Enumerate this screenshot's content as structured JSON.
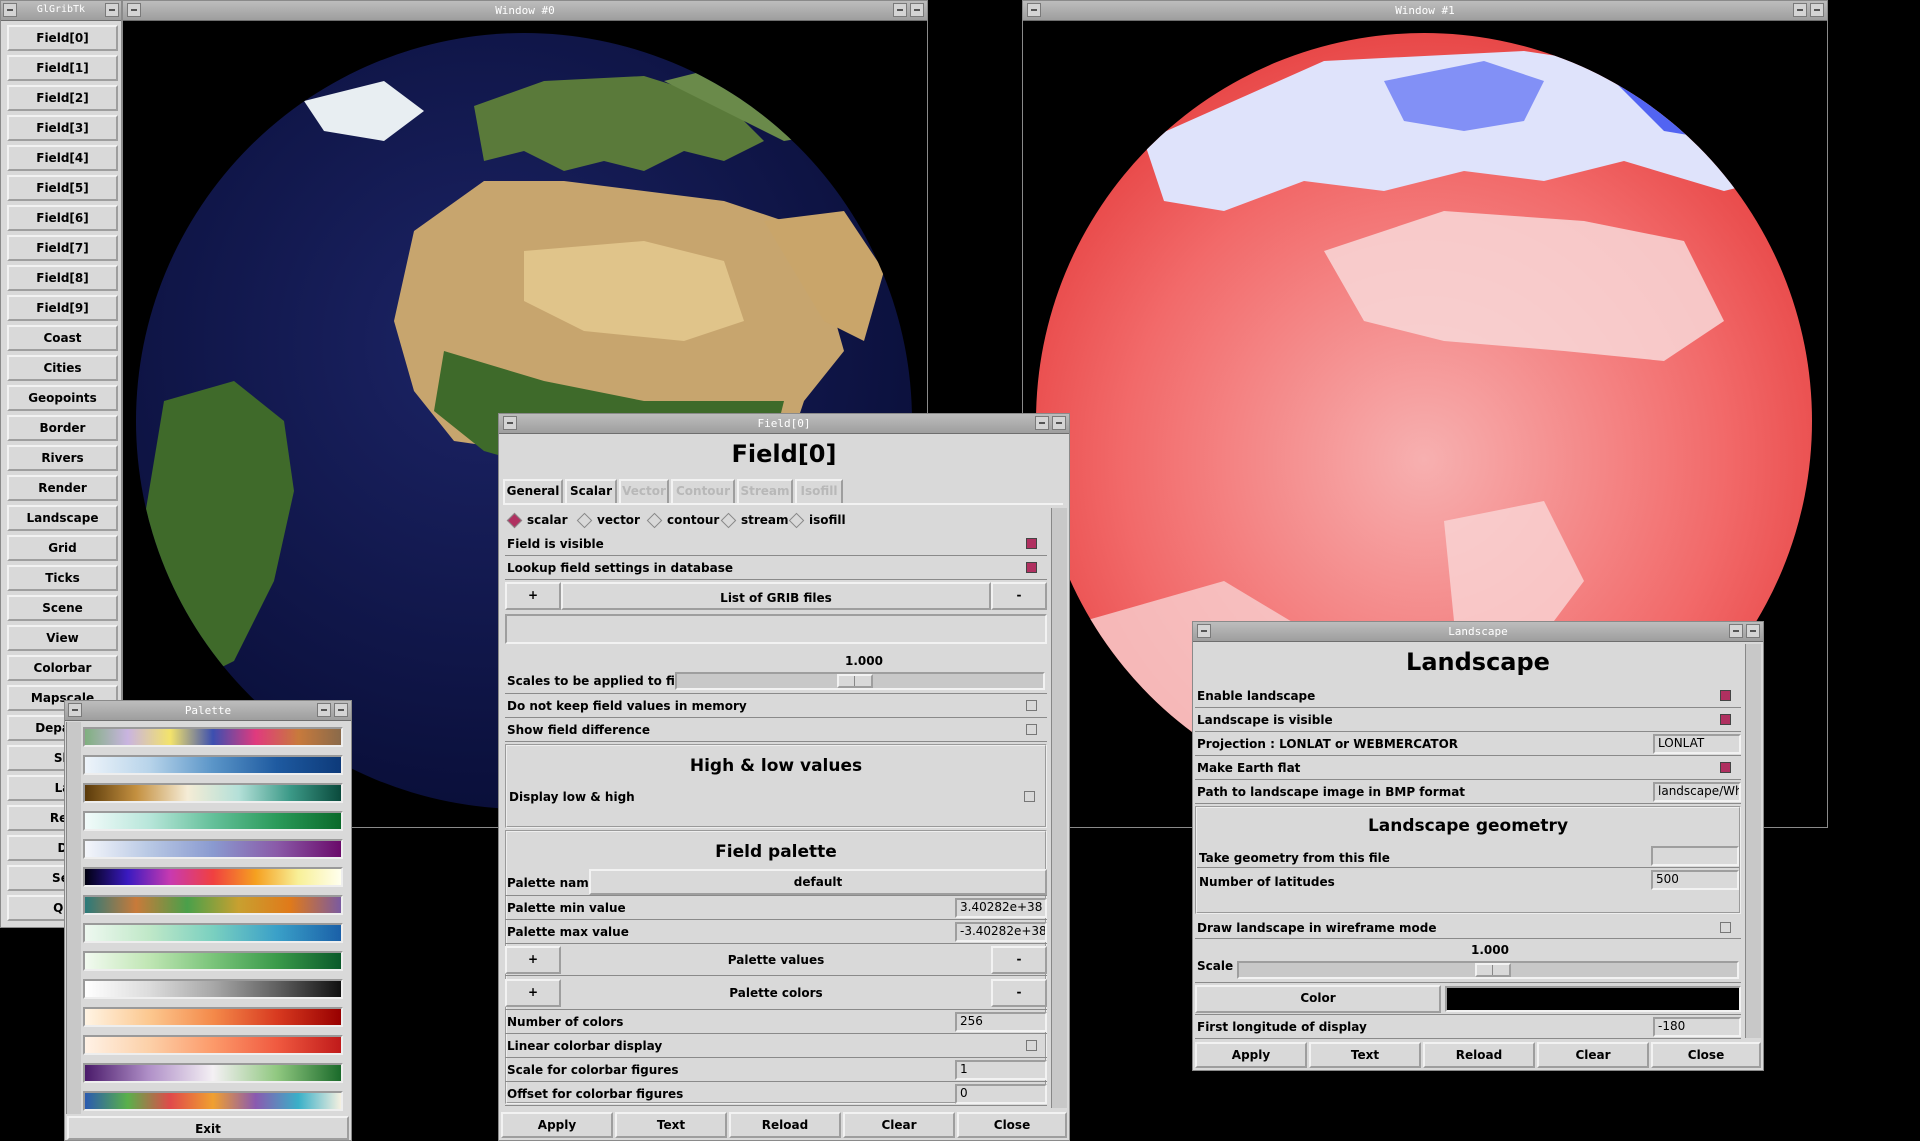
{
  "main_menu": {
    "title": "GlGribTk",
    "items": [
      "Field[0]",
      "Field[1]",
      "Field[2]",
      "Field[3]",
      "Field[4]",
      "Field[5]",
      "Field[6]",
      "Field[7]",
      "Field[8]",
      "Field[9]",
      "Coast",
      "Cities",
      "Geopoints",
      "Border",
      "Rivers",
      "Render",
      "Landscape",
      "Grid",
      "Ticks",
      "Scene",
      "View",
      "Colorbar",
      "Mapscale",
      "Departe",
      "Sh",
      "La",
      "Rev",
      "D",
      "Sel",
      "Qu"
    ]
  },
  "window0": {
    "title": "Window #0"
  },
  "window1": {
    "title": "Window #1"
  },
  "palette_window": {
    "title": "Palette",
    "exit_label": "Exit",
    "palettes": [
      [
        "#7fb07f",
        "#c9b4e0",
        "#f3e36b",
        "#3c4fb0",
        "#e03a7e",
        "#c87a3c",
        "#8a6a4a"
      ],
      [
        "#eef4fa",
        "#b8d4ea",
        "#5a95c8",
        "#1e5aa0",
        "#0d3a7a"
      ],
      [
        "#5a3a0a",
        "#c49040",
        "#f5ecd6",
        "#b4e0d8",
        "#3c9a88",
        "#0a4a3c"
      ],
      [
        "#f2fbfa",
        "#b8e6da",
        "#64c09a",
        "#2a9a5a",
        "#0a6a2a"
      ],
      [
        "#f4f6fb",
        "#b8c8e4",
        "#8a9ad0",
        "#8a5aa8",
        "#6a0a6a"
      ],
      [
        "#000010",
        "#3a1ac0",
        "#c83ab0",
        "#f04040",
        "#f5a020",
        "#f8f098",
        "#ffffee"
      ],
      [
        "#2a7a7a",
        "#c87a3a",
        "#4aa04a",
        "#c8a030",
        "#e07a1a",
        "#7a5aa0"
      ],
      [
        "#eef8f0",
        "#c0e8c8",
        "#7ad0c0",
        "#3aa0c8",
        "#1a60a8"
      ],
      [
        "#f2faf0",
        "#c0e6b4",
        "#7ac47a",
        "#3a9a4a",
        "#0a5a2a"
      ],
      [
        "#ffffff",
        "#dcdcdc",
        "#a8a8a8",
        "#606060",
        "#101010"
      ],
      [
        "#fff4e4",
        "#fcc890",
        "#f48a4a",
        "#d83a20",
        "#980000"
      ],
      [
        "#fff2e6",
        "#fcd0a8",
        "#fc9a6a",
        "#f05a40",
        "#c01a1a"
      ],
      [
        "#4a1a6a",
        "#b090c8",
        "#f4f0f4",
        "#90c880",
        "#1a6a2a"
      ],
      [
        "#2a5ab0",
        "#5ab04a",
        "#e04a4a",
        "#f0a030",
        "#8a5ab0",
        "#3ab0c8",
        "#f5f0e0"
      ]
    ]
  },
  "field_window": {
    "title": "Field[0]",
    "heading": "Field[0]",
    "tabs": [
      {
        "label": "General",
        "state": "active"
      },
      {
        "label": "Scalar",
        "state": "enabled"
      },
      {
        "label": "Vector",
        "state": "disabled"
      },
      {
        "label": "Contour",
        "state": "disabled"
      },
      {
        "label": "Stream",
        "state": "disabled"
      },
      {
        "label": "Isofill",
        "state": "disabled"
      }
    ],
    "type_options": [
      "scalar",
      "vector",
      "contour",
      "stream",
      "isofill"
    ],
    "type_selected": "scalar",
    "field_visible_label": "Field is visible",
    "lookup_label": "Lookup field settings in database",
    "list_grib_label": "List of GRIB files",
    "plus": "+",
    "minus": "-",
    "scale_value": "1.000",
    "scales_label": "Scales to be applied to fields",
    "nokeep_label": "Do not keep field values in memory",
    "showdiff_label": "Show field difference",
    "highlow_heading": "High & low values",
    "display_lowhigh_label": "Display low & high",
    "palette_heading": "Field palette",
    "palette_name_label": "Palette name",
    "palette_name_value": "default",
    "palette_min_label": "Palette min value",
    "palette_min_value": "3.40282e+38",
    "palette_max_label": "Palette max value",
    "palette_max_value": "-3.40282e+38",
    "palette_values_label": "Palette values",
    "palette_colors_label": "Palette colors",
    "num_colors_label": "Number of colors",
    "num_colors_value": "256",
    "linear_label": "Linear colorbar display",
    "scale_figures_label": "Scale for colorbar figures",
    "scale_figures_value": "1",
    "offset_figures_label": "Offset for colorbar figures",
    "offset_figures_value": "0",
    "buttons": [
      "Apply",
      "Text",
      "Reload",
      "Clear",
      "Close"
    ]
  },
  "landscape_window": {
    "title": "Landscape",
    "heading": "Landscape",
    "enable_label": "Enable landscape",
    "visible_label": "Landscape is visible",
    "projection_label": "Projection : LONLAT or WEBMERCATOR",
    "projection_value": "LONLAT",
    "flat_label": "Make Earth flat",
    "path_label": "Path to landscape image in BMP format",
    "path_value": "landscape/Who",
    "geometry_heading": "Landscape geometry",
    "geometry_file_label": "Take geometry from this file",
    "geometry_file_value": "",
    "num_lat_label": "Number of latitudes",
    "num_lat_value": "500",
    "wireframe_label": "Draw landscape in wireframe mode",
    "scale_value": "1.000",
    "scale_label": "Scale",
    "color_label": "Color",
    "first_lon_label": "First longitude of display",
    "first_lon_value": "-180",
    "buttons": [
      "Apply",
      "Text",
      "Reload",
      "Clear",
      "Close"
    ]
  }
}
